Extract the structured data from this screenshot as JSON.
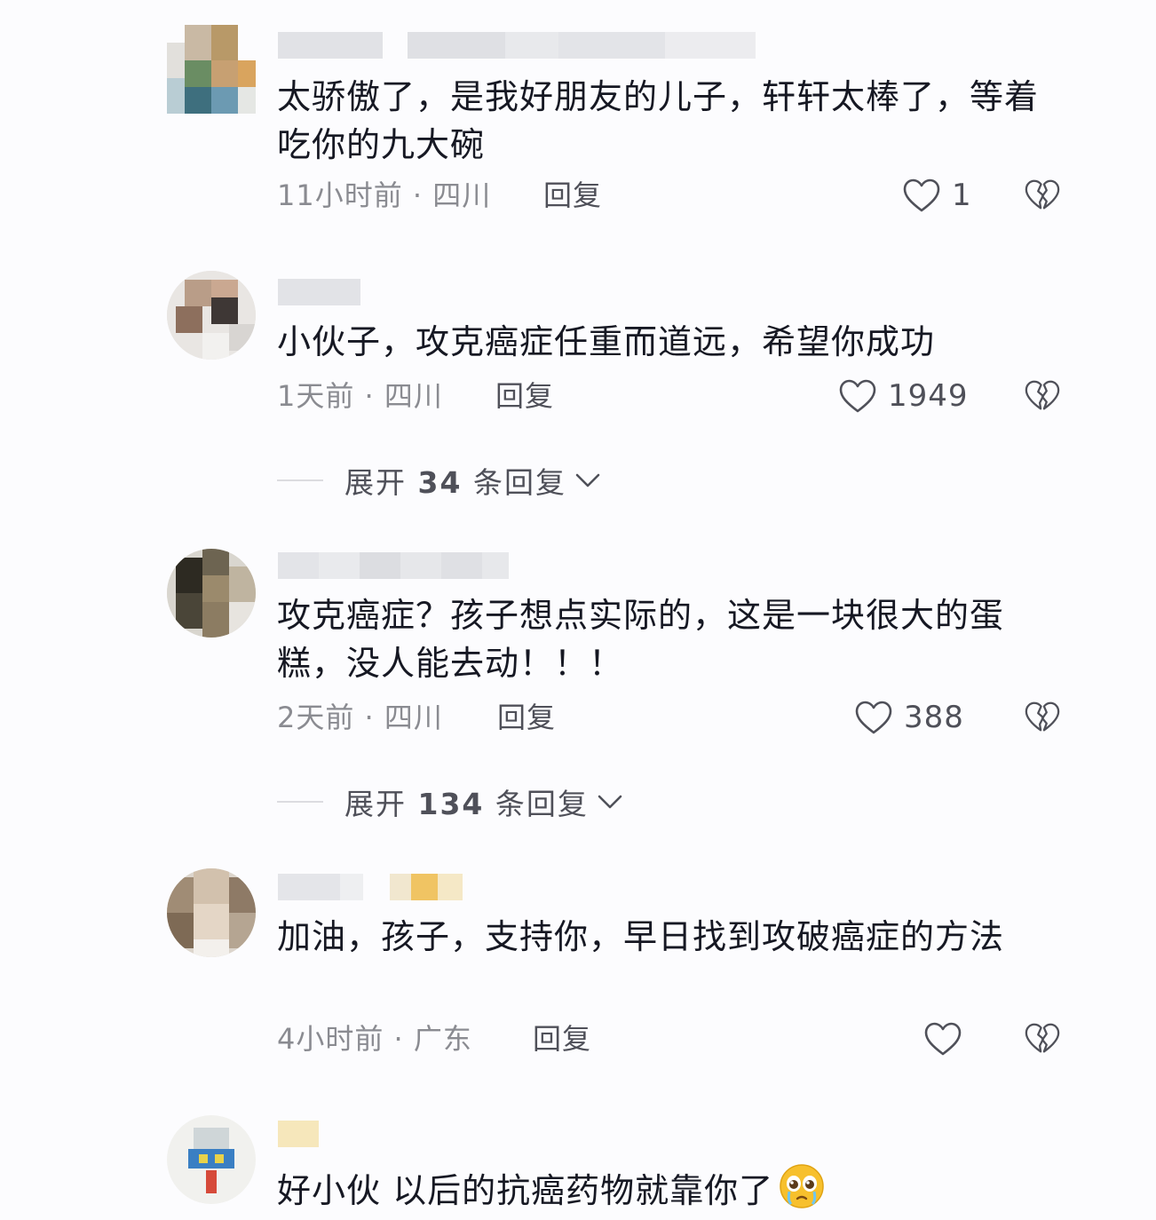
{
  "comments": [
    {
      "text": "太骄傲了，是我好朋友的儿子，轩轩太棒了，等着吃你的九大碗",
      "time": "11小时前",
      "location": "四川",
      "reply_label": "回复",
      "likes": "1"
    },
    {
      "text": "小伙子，攻克癌症任重而道远，希望你成功",
      "time": "1天前",
      "location": "四川",
      "reply_label": "回复",
      "likes": "1949",
      "expand": {
        "prefix": "展开",
        "count": "34",
        "suffix": "条回复"
      }
    },
    {
      "text": "攻克癌症？孩子想点实际的，这是一块很大的蛋糕，没人能去动！！！",
      "time": "2天前",
      "location": "四川",
      "reply_label": "回复",
      "likes": "388",
      "expand": {
        "prefix": "展开",
        "count": "134",
        "suffix": "条回复"
      }
    },
    {
      "text": "加油，孩子，支持你，早日找到攻破癌症的方法",
      "time": "4小时前",
      "location": "广东",
      "reply_label": "回复",
      "likes": ""
    },
    {
      "text": "好小伙 以后的抗癌药物就靠你了",
      "emoji": "crying-face-emoji"
    }
  ],
  "separator": " · ",
  "icons": {
    "like": "heart-outline-icon",
    "dislike": "broken-heart-icon",
    "expand": "chevron-down-icon"
  },
  "colors": {
    "text": "#161823",
    "meta": "#8a8b91",
    "action": "#4f5059"
  }
}
